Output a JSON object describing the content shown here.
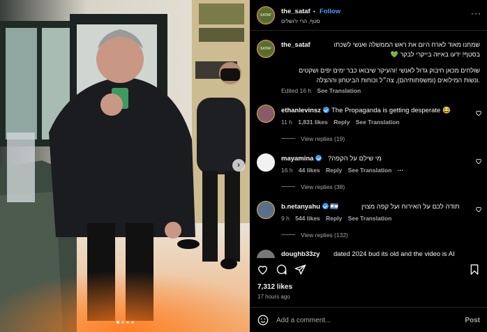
{
  "post": {
    "username": "the_sataf",
    "follow_label": "Follow",
    "separator": "•",
    "location": "סטף, הרי ירושלים",
    "more_label": "···",
    "avatar_text": "SATAF"
  },
  "caption": {
    "username": "the_sataf",
    "line1": "שמחנו מאוד לארח היום את ראש הממשלה ואנשי לשכתו",
    "line2": "בסטף! ידעו באיזה בייקרי לבקר 💚",
    "line3": "שולחים מכאן חיבוק גדול לאנשי !והעיקר שיבואו כבר ימים יפים ושקטים",
    "line4": ".ונשות המילואים (ומשפחותיהם), צה״ל וכוחות הביטחון וההצלה",
    "edited": "Edited",
    "age": "16 h",
    "see_translation": "See Translation"
  },
  "comments": [
    {
      "username": "ethanlevinsz",
      "verified": true,
      "text": "The Propaganda is getting desperate 😂",
      "age": "11 h",
      "likes": "1,831 likes",
      "reply": "Reply",
      "see_translation": "See Translation",
      "view_replies": "View replies (19)"
    },
    {
      "username": "mayamina",
      "verified": true,
      "text": "מי שילם על הקפה?",
      "age": "16 h",
      "likes": "44 likes",
      "reply": "Reply",
      "see_translation": "See Translation",
      "more": "···",
      "view_replies": "View replies (38)"
    },
    {
      "username": "b.netanyahu",
      "verified": true,
      "flag": "🇮🇱",
      "text": "תודה לכם על האירוח ועל קפה מצוין",
      "age": "9 h",
      "likes": "544 likes",
      "reply": "Reply",
      "see_translation": "See Translation",
      "view_replies": "View replies (132)"
    },
    {
      "username": "doughb33zy",
      "text": "dated 2024 bud its old and the video is AI"
    }
  ],
  "footer": {
    "likes": "7,312 likes",
    "time": "17 hours ago",
    "add_comment_placeholder": "Add a comment...",
    "post_label": "Post"
  },
  "icons": {
    "like": "heart-icon",
    "comment": "comment-icon",
    "share": "share-icon",
    "save": "bookmark-icon",
    "emoji": "emoji-icon",
    "next": "chevron-right-icon"
  },
  "colors": {
    "background": "#000000",
    "link_blue": "#4c9dff",
    "verified_blue": "#3897f0",
    "secondary_text": "#a8a8a8"
  }
}
